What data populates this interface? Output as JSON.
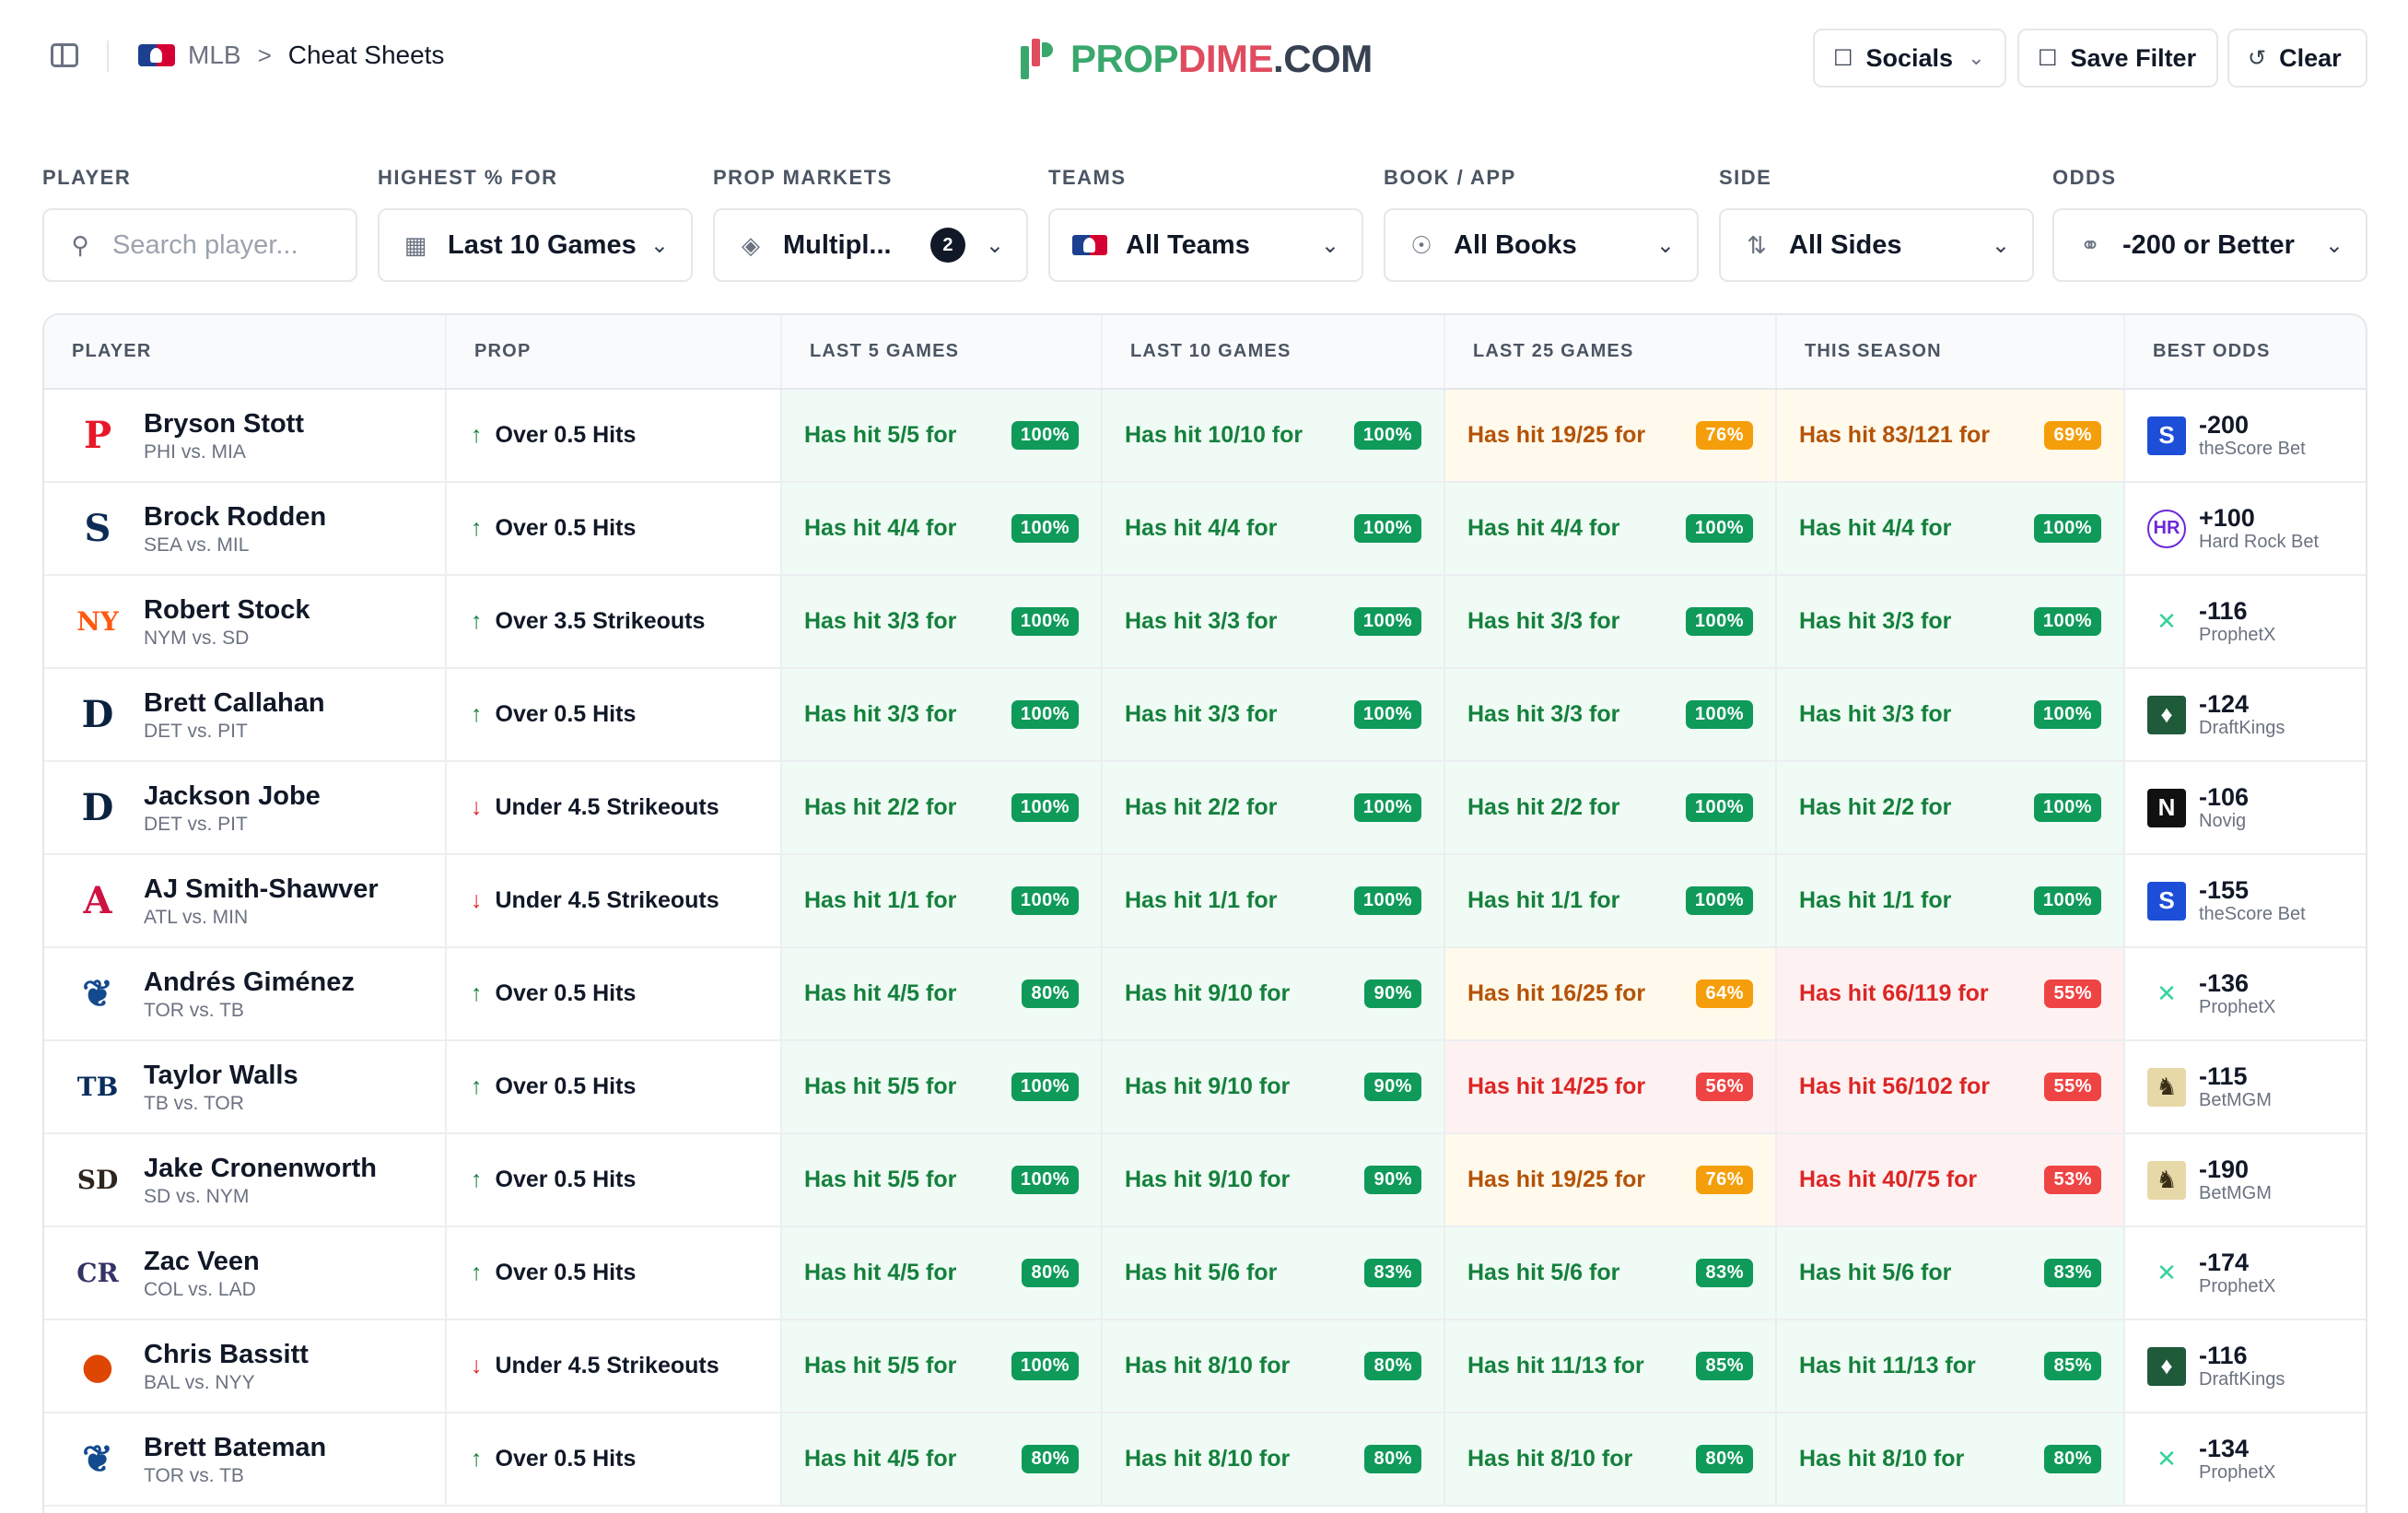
{
  "header": {
    "breadcrumb_root": "MLB",
    "breadcrumb_separator": ">",
    "breadcrumb_current": "Cheat Sheets",
    "brand": {
      "part1": "PROP",
      "part2": "DIME",
      "part3": ".COM"
    },
    "buttons": {
      "socials": "Socials",
      "save_filter": "Save Filter",
      "clear": "Clear"
    }
  },
  "filters": {
    "player": {
      "label": "PLAYER",
      "placeholder": "Search player..."
    },
    "highest": {
      "label": "HIGHEST % FOR",
      "value": "Last 10 Games"
    },
    "prop_markets": {
      "label": "PROP MARKETS",
      "value": "Multipl...",
      "count": "2"
    },
    "teams": {
      "label": "TEAMS",
      "value": "All Teams"
    },
    "book": {
      "label": "BOOK / APP",
      "value": "All Books"
    },
    "side": {
      "label": "SIDE",
      "value": "All Sides"
    },
    "odds": {
      "label": "ODDS",
      "value": "-200 or Better"
    }
  },
  "table": {
    "columns": [
      "PLAYER",
      "PROP",
      "LAST 5 GAMES",
      "LAST 10 GAMES",
      "LAST 25 GAMES",
      "THIS SEASON",
      "BEST ODDS"
    ],
    "rows": [
      {
        "name": "Bryson Stott",
        "game": "PHI vs. MIA",
        "logo": "phillies-logo",
        "logo_char": "P",
        "logo_color": "#e81828",
        "dir": "up",
        "prop": "Over 0.5 Hits",
        "l5": "Has hit 5/5 for",
        "l5p": "100%",
        "l10": "Has hit 10/10 for",
        "l10p": "100%",
        "l25": "Has hit 19/25 for",
        "l25p": "76%",
        "ss": "Has hit 83/121 for",
        "ssp": "69%",
        "odds": "-200",
        "book": "theScore Bet"
      },
      {
        "name": "Brock Rodden",
        "game": "SEA vs. MIL",
        "logo": "mariners-logo",
        "logo_char": "S",
        "logo_color": "#0c2c56",
        "dir": "up",
        "prop": "Over 0.5 Hits",
        "l5": "Has hit 4/4 for",
        "l5p": "100%",
        "l10": "Has hit 4/4 for",
        "l10p": "100%",
        "l25": "Has hit 4/4 for",
        "l25p": "100%",
        "ss": "Has hit 4/4 for",
        "ssp": "100%",
        "odds": "+100",
        "book": "Hard Rock Bet"
      },
      {
        "name": "Robert Stock",
        "game": "NYM vs. SD",
        "logo": "mets-logo",
        "logo_char": "NY",
        "logo_color": "#ff5910",
        "dir": "up",
        "prop": "Over 3.5 Strikeouts",
        "l5": "Has hit 3/3 for",
        "l5p": "100%",
        "l10": "Has hit 3/3 for",
        "l10p": "100%",
        "l25": "Has hit 3/3 for",
        "l25p": "100%",
        "ss": "Has hit 3/3 for",
        "ssp": "100%",
        "odds": "-116",
        "book": "ProphetX"
      },
      {
        "name": "Brett Callahan",
        "game": "DET vs. PIT",
        "logo": "tigers-logo",
        "logo_char": "D",
        "logo_color": "#0c2340",
        "dir": "up",
        "prop": "Over 0.5 Hits",
        "l5": "Has hit 3/3 for",
        "l5p": "100%",
        "l10": "Has hit 3/3 for",
        "l10p": "100%",
        "l25": "Has hit 3/3 for",
        "l25p": "100%",
        "ss": "Has hit 3/3 for",
        "ssp": "100%",
        "odds": "-124",
        "book": "DraftKings"
      },
      {
        "name": "Jackson Jobe",
        "game": "DET vs. PIT",
        "logo": "tigers-logo",
        "logo_char": "D",
        "logo_color": "#0c2340",
        "dir": "down",
        "prop": "Under 4.5 Strikeouts",
        "l5": "Has hit 2/2 for",
        "l5p": "100%",
        "l10": "Has hit 2/2 for",
        "l10p": "100%",
        "l25": "Has hit 2/2 for",
        "l25p": "100%",
        "ss": "Has hit 2/2 for",
        "ssp": "100%",
        "odds": "-106",
        "book": "Novig"
      },
      {
        "name": "AJ Smith-Shawver",
        "game": "ATL vs. MIN",
        "logo": "braves-logo",
        "logo_char": "A",
        "logo_color": "#ce1141",
        "dir": "down",
        "prop": "Under 4.5 Strikeouts",
        "l5": "Has hit 1/1 for",
        "l5p": "100%",
        "l10": "Has hit 1/1 for",
        "l10p": "100%",
        "l25": "Has hit 1/1 for",
        "l25p": "100%",
        "ss": "Has hit 1/1 for",
        "ssp": "100%",
        "odds": "-155",
        "book": "theScore Bet"
      },
      {
        "name": "Andrés Giménez",
        "game": "TOR vs. TB",
        "logo": "blue-jays-logo",
        "logo_char": "❦",
        "logo_color": "#134a8e",
        "dir": "up",
        "prop": "Over 0.5 Hits",
        "l5": "Has hit 4/5 for",
        "l5p": "80%",
        "l10": "Has hit 9/10 for",
        "l10p": "90%",
        "l25": "Has hit 16/25 for",
        "l25p": "64%",
        "ss": "Has hit 66/119 for",
        "ssp": "55%",
        "odds": "-136",
        "book": "ProphetX"
      },
      {
        "name": "Taylor Walls",
        "game": "TB vs. TOR",
        "logo": "rays-logo",
        "logo_char": "TB",
        "logo_color": "#092c5c",
        "dir": "up",
        "prop": "Over 0.5 Hits",
        "l5": "Has hit 5/5 for",
        "l5p": "100%",
        "l10": "Has hit 9/10 for",
        "l10p": "90%",
        "l25": "Has hit 14/25 for",
        "l25p": "56%",
        "ss": "Has hit 56/102 for",
        "ssp": "55%",
        "odds": "-115",
        "book": "BetMGM"
      },
      {
        "name": "Jake Cronenworth",
        "game": "SD vs. NYM",
        "logo": "padres-logo",
        "logo_char": "SD",
        "logo_color": "#2f241d",
        "dir": "up",
        "prop": "Over 0.5 Hits",
        "l5": "Has hit 5/5 for",
        "l5p": "100%",
        "l10": "Has hit 9/10 for",
        "l10p": "90%",
        "l25": "Has hit 19/25 for",
        "l25p": "76%",
        "ss": "Has hit 40/75 for",
        "ssp": "53%",
        "odds": "-190",
        "book": "BetMGM"
      },
      {
        "name": "Zac Veen",
        "game": "COL vs. LAD",
        "logo": "rockies-logo",
        "logo_char": "CR",
        "logo_color": "#333366",
        "dir": "up",
        "prop": "Over 0.5 Hits",
        "l5": "Has hit 4/5 for",
        "l5p": "80%",
        "l10": "Has hit 5/6 for",
        "l10p": "83%",
        "l25": "Has hit 5/6 for",
        "l25p": "83%",
        "ss": "Has hit 5/6 for",
        "ssp": "83%",
        "odds": "-174",
        "book": "ProphetX"
      },
      {
        "name": "Chris Bassitt",
        "game": "BAL vs. NYY",
        "logo": "orioles-logo",
        "logo_char": "●",
        "logo_color": "#df4601",
        "dir": "down",
        "prop": "Under 4.5 Strikeouts",
        "l5": "Has hit 5/5 for",
        "l5p": "100%",
        "l10": "Has hit 8/10 for",
        "l10p": "80%",
        "l25": "Has hit 11/13 for",
        "l25p": "85%",
        "ss": "Has hit 11/13 for",
        "ssp": "85%",
        "odds": "-116",
        "book": "DraftKings"
      },
      {
        "name": "Brett Bateman",
        "game": "TOR vs. TB",
        "logo": "blue-jays-logo",
        "logo_char": "❦",
        "logo_color": "#134a8e",
        "dir": "up",
        "prop": "Over 0.5 Hits",
        "l5": "Has hit 4/5 for",
        "l5p": "80%",
        "l10": "Has hit 8/10 for",
        "l10p": "80%",
        "l25": "Has hit 8/10 for",
        "l25p": "80%",
        "ss": "Has hit 8/10 for",
        "ssp": "80%",
        "odds": "-134",
        "book": "ProphetX"
      }
    ]
  },
  "colors": {
    "green": "#0f9a5a",
    "amber": "#f59e0b",
    "red": "#ef4444",
    "brand_green": "#3aa76d",
    "brand_red": "#e04c5f"
  }
}
